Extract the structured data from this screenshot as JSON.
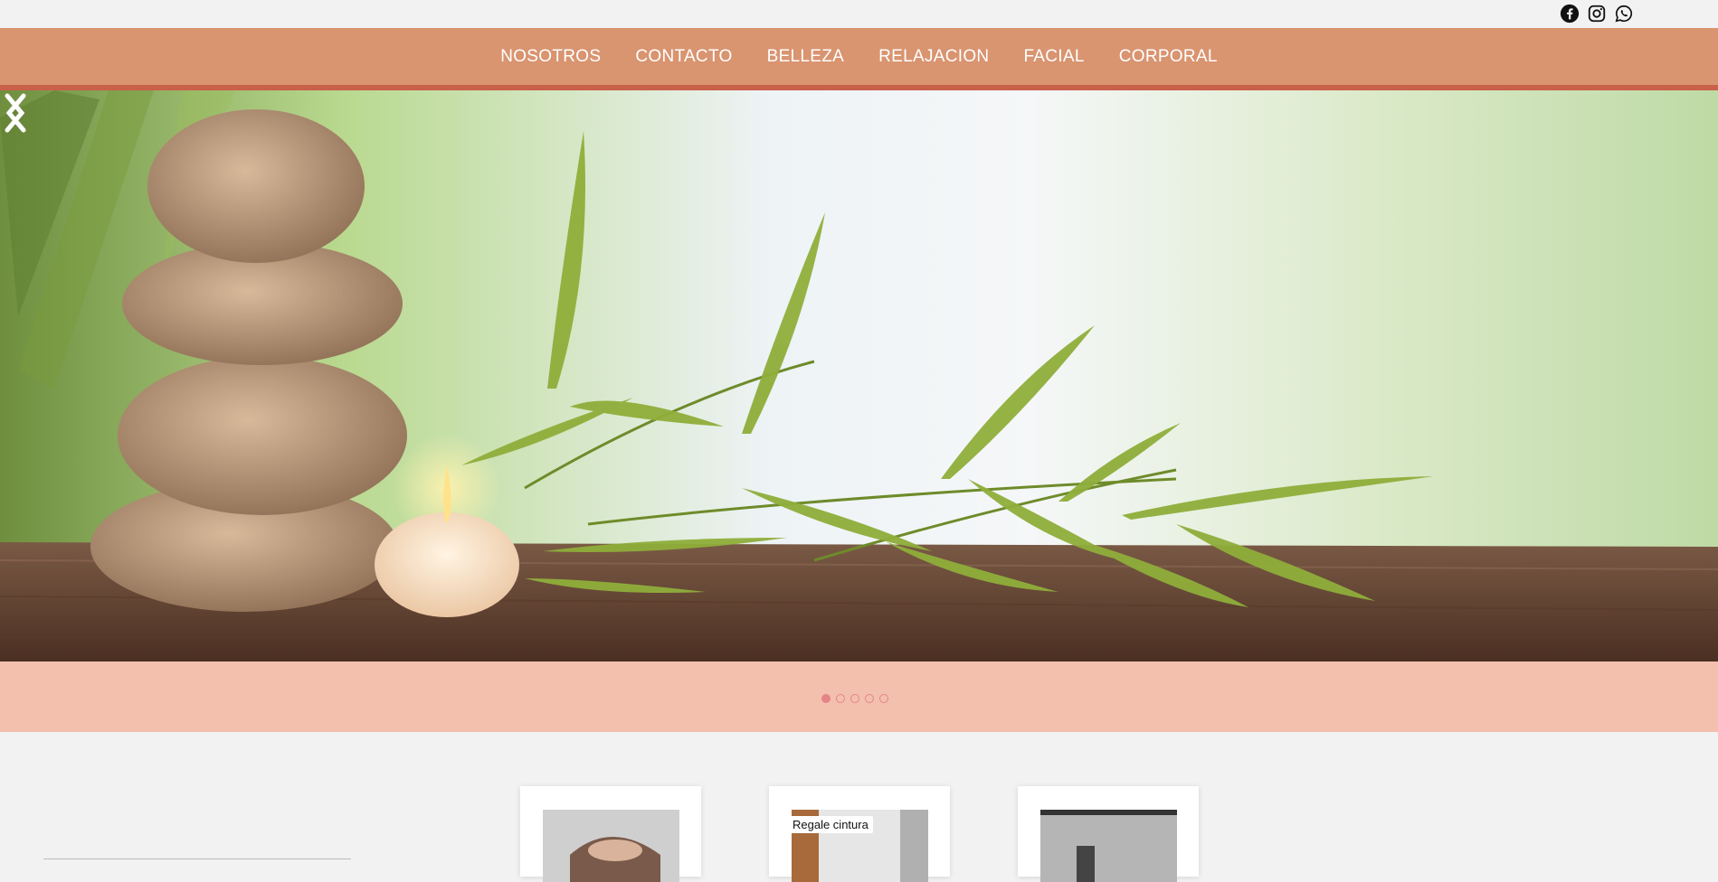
{
  "social": {
    "icons": [
      "facebook-icon",
      "instagram-icon",
      "whatsapp-icon"
    ]
  },
  "nav": {
    "items": [
      {
        "label": "NOSOTROS"
      },
      {
        "label": "CONTACTO"
      },
      {
        "label": "BELLEZA"
      },
      {
        "label": "RELAJACION"
      },
      {
        "label": "FACIAL"
      },
      {
        "label": "CORPORAL"
      }
    ]
  },
  "slider": {
    "slide_count": 5,
    "active_slide": 1
  },
  "cards": [
    {
      "label": ""
    },
    {
      "label": "Regale cintura"
    },
    {
      "label": ""
    }
  ],
  "colors": {
    "nav_bg": "#d99470",
    "nav_border": "#c8604a",
    "dots_band": "#f3c0ae",
    "dot_accent": "#e48486",
    "page_bg": "#f2f2f2"
  }
}
